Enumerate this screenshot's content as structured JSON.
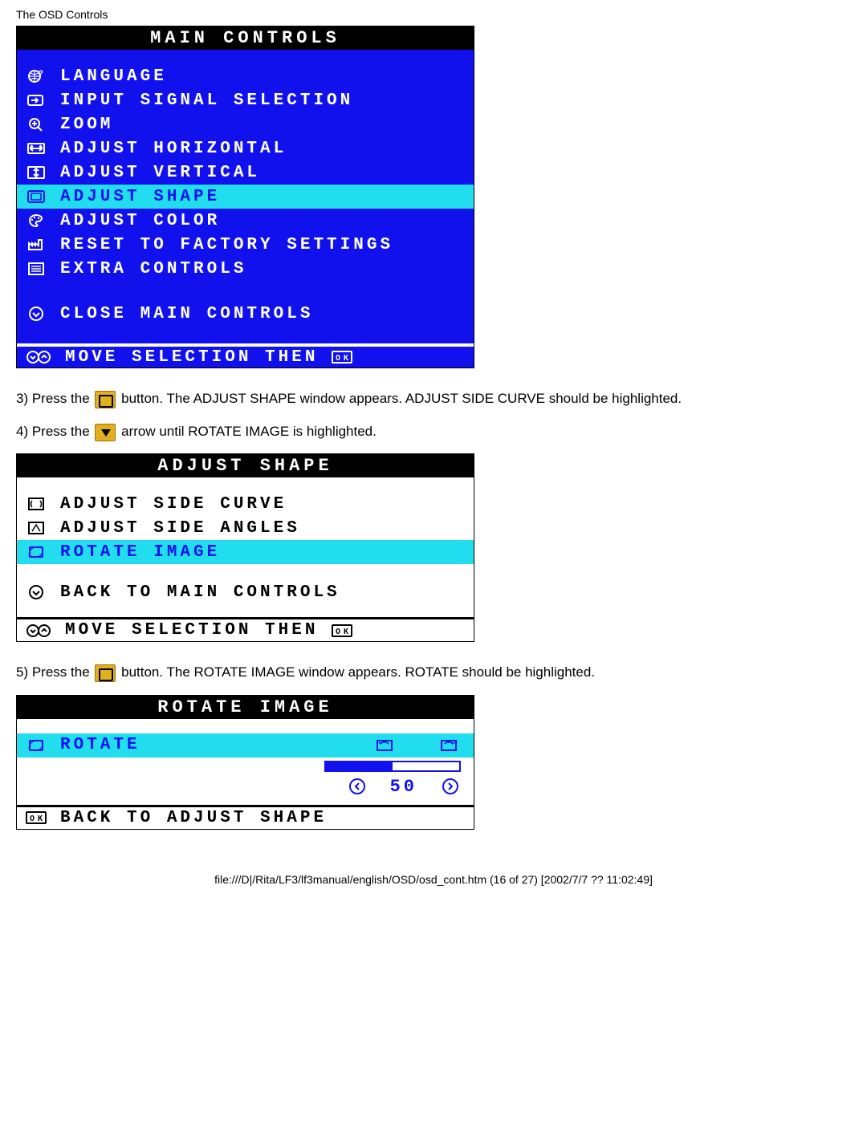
{
  "page_header": "The OSD Controls",
  "main_controls": {
    "title": "MAIN CONTROLS",
    "items": [
      {
        "icon": "globe-q",
        "label": "LANGUAGE"
      },
      {
        "icon": "input-arrow",
        "label": "INPUT SIGNAL SELECTION"
      },
      {
        "icon": "magnify-plus",
        "label": "ZOOM"
      },
      {
        "icon": "lr-arrows",
        "label": "ADJUST HORIZONTAL"
      },
      {
        "icon": "ud-arrows",
        "label": "ADJUST VERTICAL"
      },
      {
        "icon": "shape-screen",
        "label": "ADJUST SHAPE",
        "highlight": true
      },
      {
        "icon": "palette",
        "label": "ADJUST COLOR"
      },
      {
        "icon": "factory",
        "label": "RESET TO FACTORY SETTINGS"
      },
      {
        "icon": "list",
        "label": "EXTRA CONTROLS"
      }
    ],
    "close": {
      "icon": "down-circ",
      "label": "CLOSE MAIN CONTROLS"
    },
    "footer": {
      "icon": "updown-circ",
      "label": "MOVE SELECTION THEN",
      "end_icon": "ok-box"
    }
  },
  "text": {
    "line3a": "3) Press the ",
    "line3b": " button. The ADJUST SHAPE window appears. ADJUST SIDE CURVE should be highlighted.",
    "line4a": "4) Press the ",
    "line4b": " arrow until ROTATE IMAGE is highlighted.",
    "line5a": "5) Press the ",
    "line5b": " button. The ROTATE IMAGE window appears. ROTATE should be highlighted."
  },
  "adjust_shape": {
    "title": "ADJUST SHAPE",
    "items": [
      {
        "icon": "side-curve",
        "label": "ADJUST SIDE CURVE"
      },
      {
        "icon": "side-angle",
        "label": "ADJUST SIDE ANGLES"
      },
      {
        "icon": "rotate-screen",
        "label": "ROTATE IMAGE",
        "highlight": true
      }
    ],
    "back": {
      "icon": "down-circ",
      "label": "BACK TO MAIN CONTROLS"
    },
    "footer": {
      "icon": "updown-circ",
      "label": "MOVE SELECTION THEN",
      "end_icon": "ok-box"
    }
  },
  "rotate_image": {
    "title": "ROTATE IMAGE",
    "item": {
      "icon": "rotate-screen",
      "label": "ROTATE"
    },
    "value": "50",
    "footer": {
      "icon": "ok-box",
      "label": "BACK TO ADJUST SHAPE"
    }
  },
  "footer_path": "file:///D|/Rita/LF3/lf3manual/english/OSD/osd_cont.htm (16 of 27) [2002/7/7 ?? 11:02:49]"
}
